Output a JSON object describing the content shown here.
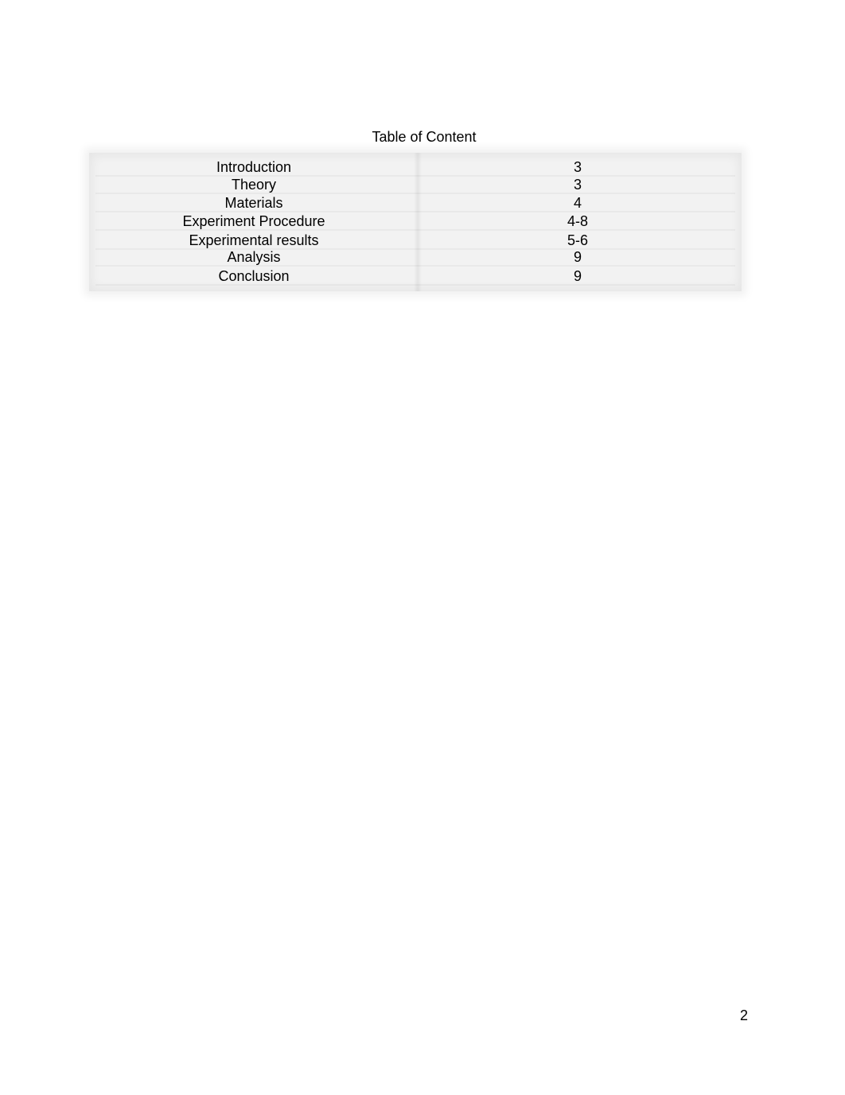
{
  "document": {
    "title": "Table of Content",
    "toc": [
      {
        "section": "Introduction",
        "page": "3"
      },
      {
        "section": "Theory",
        "page": "3"
      },
      {
        "section": "Materials",
        "page": "4"
      },
      {
        "section": "Experiment Procedure",
        "page": "4-8"
      },
      {
        "section": "Experimental results",
        "page": "5-6"
      },
      {
        "section": "Analysis",
        "page": "9"
      },
      {
        "section": "Conclusion",
        "page": "9"
      }
    ],
    "page_number": "2"
  }
}
